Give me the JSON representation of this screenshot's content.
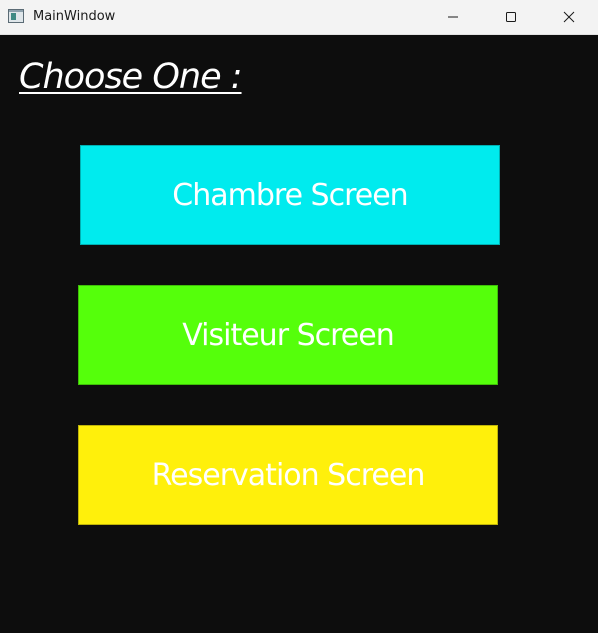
{
  "window": {
    "title": "MainWindow",
    "controls": {
      "minimize_icon": "minimize-icon",
      "maximize_icon": "maximize-icon",
      "close_icon": "close-icon"
    }
  },
  "main": {
    "heading": "Choose One :",
    "buttons": [
      {
        "label": "Chambre Screen",
        "color": "#00ebee"
      },
      {
        "label": "Visiteur Screen",
        "color": "#55ff0b"
      },
      {
        "label": "Reservation Screen",
        "color": "#fff00b"
      }
    ]
  },
  "colors": {
    "background": "#0d0d0d",
    "titlebar": "#f3f3f3",
    "text": "#ffffff"
  }
}
